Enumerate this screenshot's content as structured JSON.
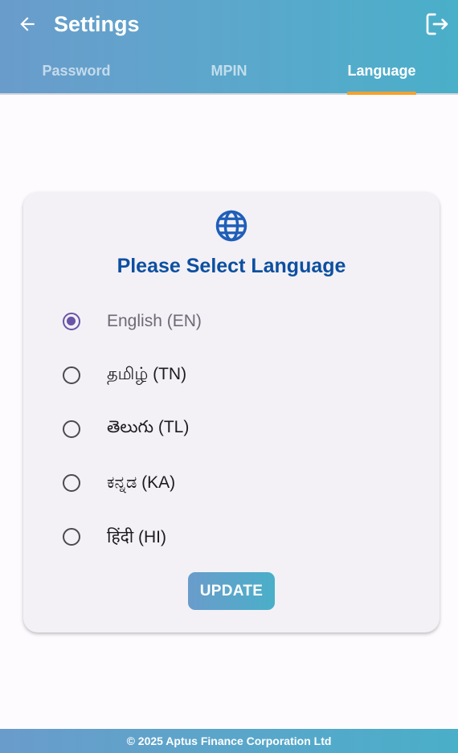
{
  "header": {
    "title": "Settings",
    "back_icon": "arrow-left-icon",
    "logout_icon": "logout-icon"
  },
  "tabs": [
    {
      "label": "Password",
      "active": false
    },
    {
      "label": "MPIN",
      "active": false
    },
    {
      "label": "Language",
      "active": true
    }
  ],
  "language_card": {
    "icon": "globe-icon",
    "title": "Please Select Language",
    "options": [
      {
        "label": "English (EN)",
        "selected": true
      },
      {
        "label": "தமிழ் (TN)",
        "selected": false
      },
      {
        "label": "తెలుగు (TL)",
        "selected": false
      },
      {
        "label": "ಕನ್ನಡ (KA)",
        "selected": false
      },
      {
        "label": "हिंदी (HI)",
        "selected": false
      }
    ],
    "update_label": "UPDATE"
  },
  "footer": {
    "text": "© 2025 Aptus Finance Corporation Ltd"
  },
  "colors": {
    "header_gradient_start": "#6a9ccb",
    "header_gradient_end": "#4aafc9",
    "tab_indicator": "#f3a12e",
    "title_blue": "#0d4fa0",
    "radio_selected": "#6a55a8"
  }
}
